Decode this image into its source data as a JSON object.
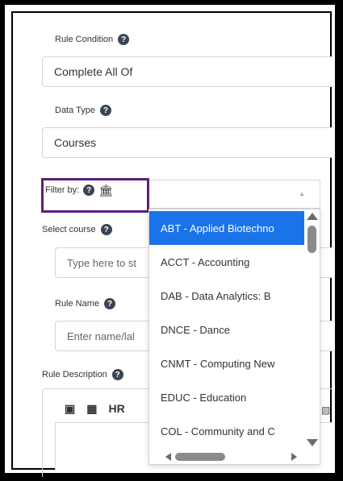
{
  "rule_condition": {
    "label": "Rule Condition",
    "value": "Complete All Of"
  },
  "data_type": {
    "label": "Data Type",
    "value": "Courses"
  },
  "filter_by": {
    "label": "Filter by:"
  },
  "select_course": {
    "label": "Select course",
    "placeholder": "Type here to st"
  },
  "rule_name": {
    "label": "Rule Name",
    "placeholder": "Enter name/lal"
  },
  "rule_description": {
    "label": "Rule Description",
    "toolbar": {
      "hr_label": "HR"
    }
  },
  "dropdown": {
    "options": [
      "ABT - Applied Biotechno",
      "ACCT - Accounting",
      "DAB - Data Analytics: B",
      "DNCE - Dance",
      "CNMT - Computing New",
      "EDUC - Education",
      "COL - Community and C"
    ],
    "selected_index": 0
  },
  "colors": {
    "selected_option": "#1a73e8",
    "filter_highlight": "#5b1f7a",
    "help_icon": "#3a4654"
  }
}
